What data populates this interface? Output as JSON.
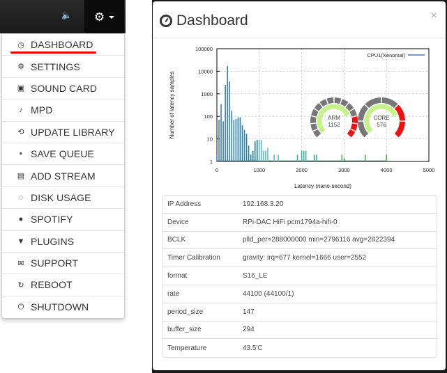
{
  "navbar": {
    "volume_icon": "volume-icon",
    "settings_icon": "gear-icon",
    "caret_icon": "caret-down-icon"
  },
  "menu": {
    "items": [
      {
        "label": "DASHBOARD",
        "icon": "dashboard-icon",
        "glyph": "◷",
        "active": true
      },
      {
        "label": "SETTINGS",
        "icon": "gear-icon",
        "glyph": "⚙"
      },
      {
        "label": "SOUND CARD",
        "icon": "chip-icon",
        "glyph": "▣"
      },
      {
        "label": "MPD",
        "icon": "music-note-icon",
        "glyph": "♪"
      },
      {
        "label": "UPDATE LIBRARY",
        "icon": "refresh-file-icon",
        "glyph": "⟲"
      },
      {
        "label": "SAVE QUEUE",
        "icon": "floppy-disk-icon",
        "glyph": "▪"
      },
      {
        "label": "ADD STREAM",
        "icon": "radio-icon",
        "glyph": "▤"
      },
      {
        "label": "DISK USAGE",
        "icon": "spinner-icon",
        "glyph": "◌"
      },
      {
        "label": "SPOTIFY",
        "icon": "spotify-icon",
        "glyph": "●"
      },
      {
        "label": "PLUGINS",
        "icon": "plug-icon",
        "glyph": "▼"
      },
      {
        "label": "SUPPORT",
        "icon": "envelope-icon",
        "glyph": "✉"
      },
      {
        "label": "REBOOT",
        "icon": "reboot-icon",
        "glyph": "↻"
      },
      {
        "label": "SHUTDOWN",
        "icon": "power-icon",
        "glyph": "⏻"
      }
    ]
  },
  "modal": {
    "title": "Dashboard",
    "close_label": "×",
    "table": [
      {
        "key": "IP Address",
        "value": "192.168.3.20"
      },
      {
        "key": "Device",
        "value": "RPi-DAC HiFi pcm1794a-hifi-0"
      },
      {
        "key": "BCLK",
        "value": "plld_per=288000000 min=2796116 avg=2822394"
      },
      {
        "key": "Timer Calibration",
        "value": "gravity: irq=677 kernel=1666 user=2552"
      },
      {
        "key": "format",
        "value": "S16_LE"
      },
      {
        "key": "rate",
        "value": "44100 (44100/1)"
      },
      {
        "key": "period_size",
        "value": "147"
      },
      {
        "key": "buffer_size",
        "value": "294"
      },
      {
        "key": "Temperature",
        "value": "43.5'C"
      }
    ]
  },
  "gauges": [
    {
      "label": "ARM",
      "value": "1152"
    },
    {
      "label": "CORE",
      "value": "576"
    }
  ],
  "chart_data": {
    "type": "bar",
    "title": "",
    "xlabel": "Latency (nano-second)",
    "ylabel": "Number of latency samples",
    "xlim": [
      0,
      5000
    ],
    "ylim": [
      1,
      100000
    ],
    "yscale": "log",
    "xticks": [
      "0",
      "1000",
      "2000",
      "3000",
      "4000",
      "5000"
    ],
    "yticks": [
      "1",
      "10",
      "100",
      "1000",
      "10000",
      "100000"
    ],
    "grid": true,
    "legend": {
      "position": "top-right",
      "entries": [
        "CPU1(Xenomai)"
      ]
    },
    "series": [
      {
        "name": "CPU1(Xenomai)",
        "x": [
          0,
          50,
          100,
          150,
          200,
          250,
          300,
          350,
          400,
          450,
          500,
          550,
          600,
          650,
          700,
          750,
          800,
          850,
          900,
          950,
          1000,
          1050,
          1100,
          1150,
          1200,
          1350,
          1450,
          1900,
          2000,
          2050,
          2100,
          2300,
          2350,
          2950,
          3500,
          4000
        ],
        "values": [
          2,
          70,
          350,
          60,
          2500,
          17000,
          3500,
          180,
          70,
          75,
          90,
          90,
          40,
          25,
          17,
          5,
          2,
          3,
          8,
          9,
          9,
          9,
          3,
          3,
          4,
          2,
          2,
          2,
          3,
          3,
          3,
          2,
          2,
          2,
          2,
          2
        ]
      }
    ]
  }
}
